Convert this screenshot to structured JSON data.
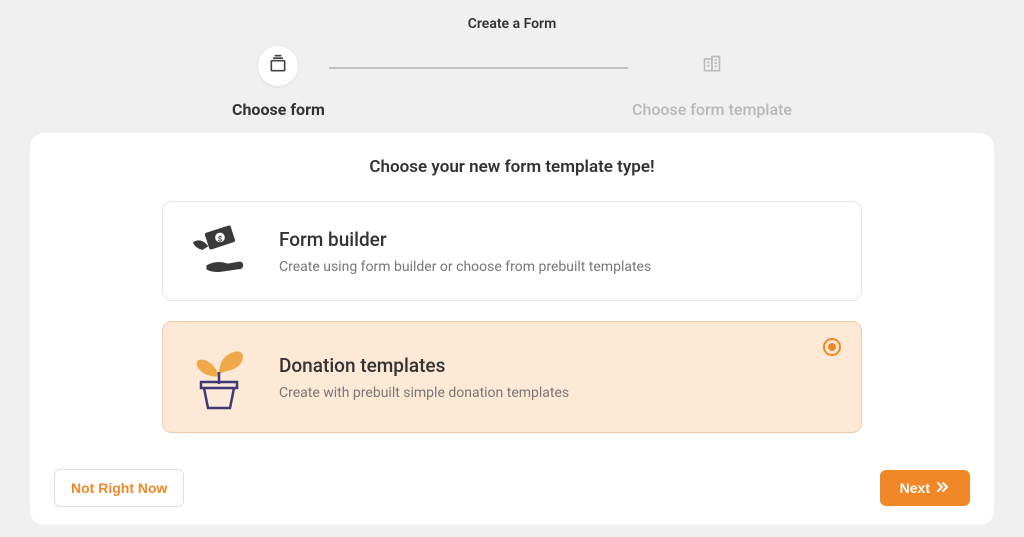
{
  "header": {
    "title": "Create a Form"
  },
  "stepper": {
    "steps": [
      {
        "label": "Choose form",
        "active": true
      },
      {
        "label": "Choose form template",
        "active": false
      }
    ]
  },
  "card": {
    "title": "Choose your new form template type!"
  },
  "options": [
    {
      "title": "Form builder",
      "desc": "Create using form builder or choose from prebuilt templates",
      "selected": false
    },
    {
      "title": "Donation templates",
      "desc": "Create with prebuilt simple donation templates",
      "selected": true
    }
  ],
  "footer": {
    "cancel": "Not Right Now",
    "next": "Next"
  },
  "colors": {
    "accent": "#f08827",
    "selectedBg": "#fde9d6"
  }
}
